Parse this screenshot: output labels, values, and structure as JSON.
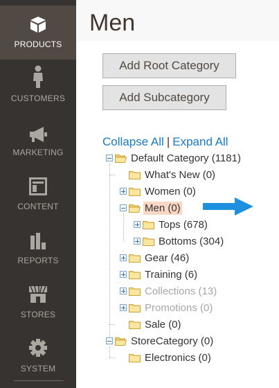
{
  "sidebar": {
    "items": [
      {
        "label": "PRODUCTS",
        "icon": "box-icon"
      },
      {
        "label": "CUSTOMERS",
        "icon": "person-icon"
      },
      {
        "label": "MARKETING",
        "icon": "megaphone-icon"
      },
      {
        "label": "CONTENT",
        "icon": "layout-icon"
      },
      {
        "label": "REPORTS",
        "icon": "bar-chart-icon"
      },
      {
        "label": "STORES",
        "icon": "storefront-icon"
      },
      {
        "label": "SYSTEM",
        "icon": "gear-icon"
      }
    ]
  },
  "page": {
    "title": "Men"
  },
  "buttons": {
    "add_root": "Add Root Category",
    "add_sub": "Add Subcategory"
  },
  "tree": {
    "collapse_all": "Collapse All",
    "separator": "|",
    "expand_all": "Expand All",
    "nodes": [
      {
        "label": "Default Category (1181)",
        "expander": "minus",
        "state": "normal"
      },
      {
        "label": "What's New (0)",
        "expander": "none",
        "state": "normal"
      },
      {
        "label": "Women (0)",
        "expander": "plus",
        "state": "normal"
      },
      {
        "label": "Men (0)",
        "expander": "minus",
        "state": "selected"
      },
      {
        "label": "Tops (678)",
        "expander": "plus",
        "state": "normal"
      },
      {
        "label": "Bottoms (304)",
        "expander": "plus",
        "state": "normal"
      },
      {
        "label": "Gear (46)",
        "expander": "plus",
        "state": "normal"
      },
      {
        "label": "Training (6)",
        "expander": "plus",
        "state": "normal"
      },
      {
        "label": "Collections (13)",
        "expander": "plus",
        "state": "disabled"
      },
      {
        "label": "Promotions (0)",
        "expander": "plus",
        "state": "disabled"
      },
      {
        "label": "Sale (0)",
        "expander": "none",
        "state": "normal"
      },
      {
        "label": "StoreCategory (0)",
        "expander": "minus",
        "state": "normal"
      },
      {
        "label": "Electronics (0)",
        "expander": "none",
        "state": "normal"
      }
    ]
  },
  "colors": {
    "sidebar_bg": "#373330",
    "sidebar_active": "#514943",
    "link": "#1979c3",
    "selected_bg": "#fad6c5",
    "arrow": "#1e90e0",
    "folder": "#f5d87a"
  }
}
